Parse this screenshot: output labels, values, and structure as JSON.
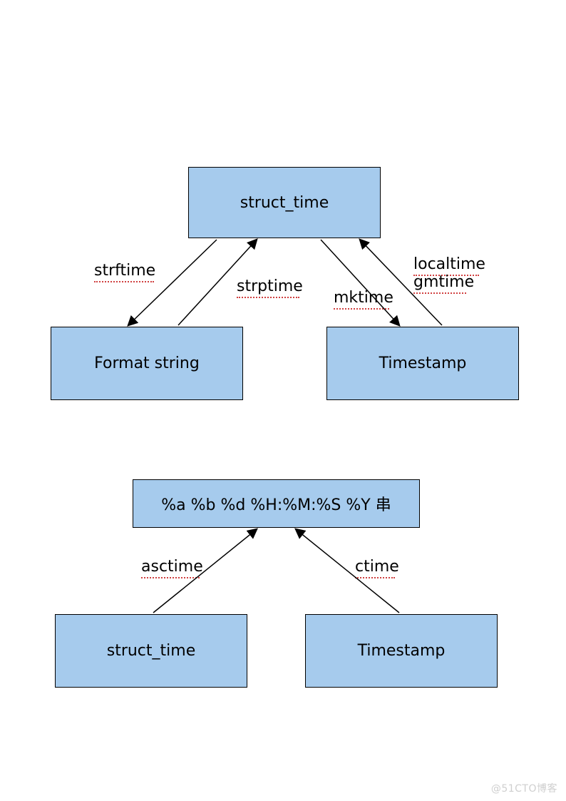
{
  "colors": {
    "box_fill": "#a6cbed",
    "box_stroke": "#000000",
    "underline": "#d04040"
  },
  "diagram1": {
    "top_box": "struct_time",
    "left_box": "Format string",
    "right_box": "Timestamp",
    "labels": {
      "strftime": "strftime",
      "strptime": "strptime",
      "mktime": "mktime",
      "localtime": "localtime",
      "gmtime": "gmtime"
    }
  },
  "diagram2": {
    "top_box": "%a %b %d %H:%M:%S %Y 串",
    "left_box": "struct_time",
    "right_box": "Timestamp",
    "labels": {
      "asctime": "asctime",
      "ctime": "ctime"
    }
  },
  "watermark": "@51CTO博客"
}
